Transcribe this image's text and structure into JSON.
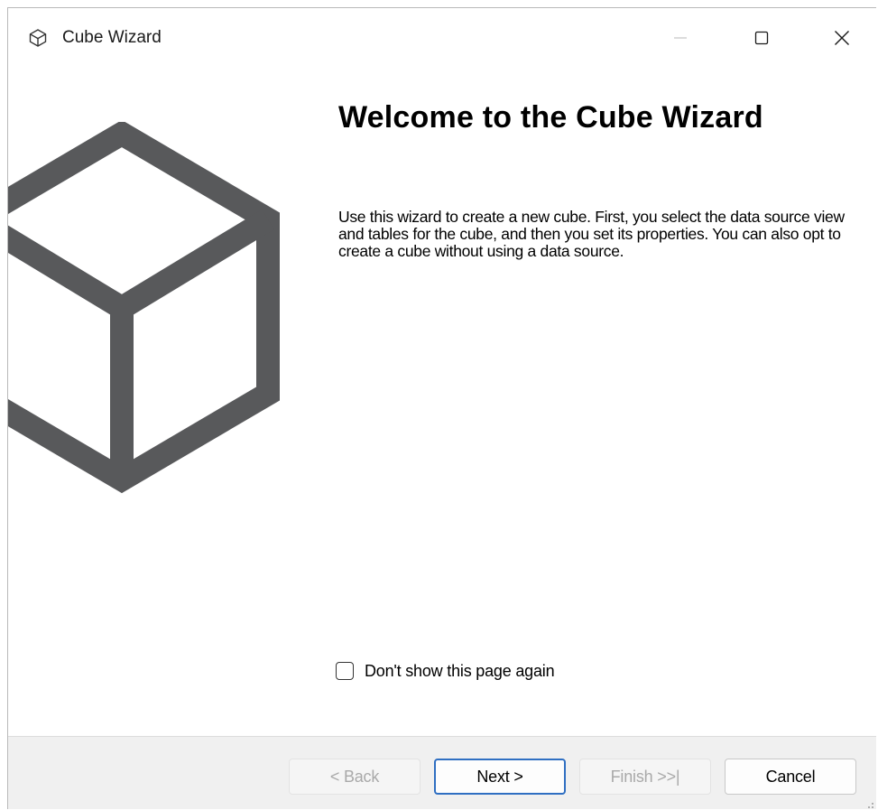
{
  "window": {
    "title": "Cube Wizard",
    "icon": "cube-outline-icon",
    "caption_buttons": [
      "minimize-icon",
      "maximize-icon",
      "close-icon"
    ]
  },
  "welcome": {
    "title": "Welcome to the Cube Wizard",
    "description": "Use this wizard to create a new cube. First, you select the data source view and tables for the cube, and then you set its properties. You can also opt to create a cube without using a data source.",
    "illustration": "cube-icon"
  },
  "options": {
    "dont_show_label": "Don't show this page again",
    "dont_show_checked": false
  },
  "buttons": {
    "back": "< Back",
    "next": "Next >",
    "finish": "Finish >>|",
    "cancel": "Cancel"
  },
  "colors": {
    "cube_stroke": "#58595b",
    "accent_border": "#2f6fc2",
    "footer_bg": "#f0f0f0",
    "disabled_text": "#a9a9a9"
  }
}
